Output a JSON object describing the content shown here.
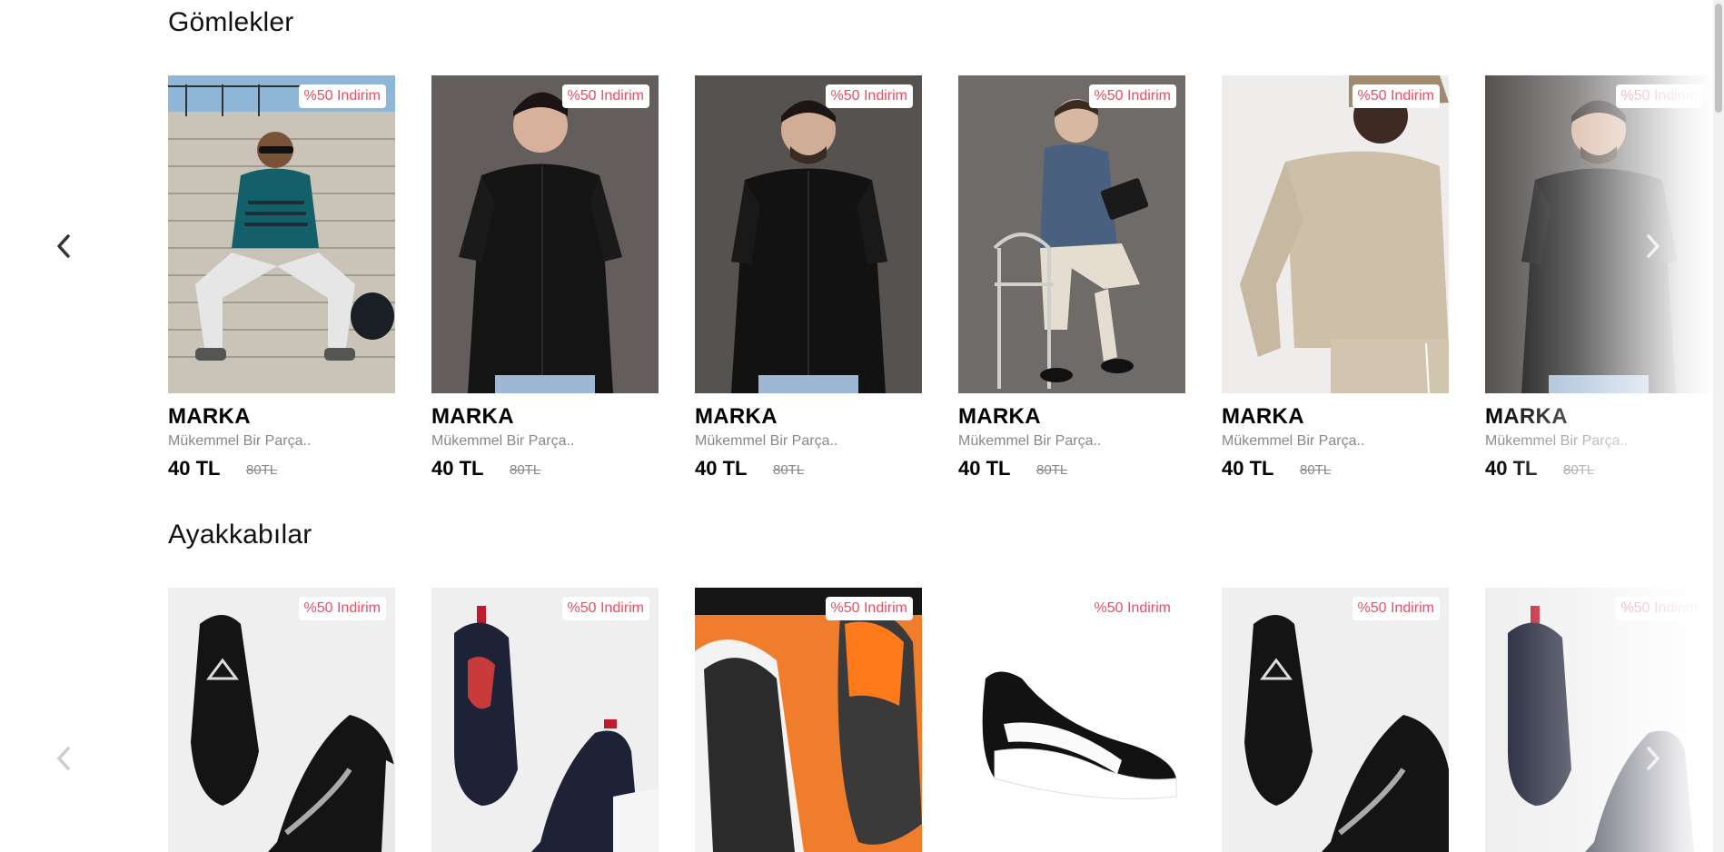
{
  "sections": [
    {
      "title": "Gömlekler",
      "products": [
        {
          "badge": "%50 Indirim",
          "brand": "MARKA",
          "desc": "Mükemmel Bir Parça..",
          "price": "40 TL",
          "old_price": "80TL"
        },
        {
          "badge": "%50 Indirim",
          "brand": "MARKA",
          "desc": "Mükemmel Bir Parça..",
          "price": "40 TL",
          "old_price": "80TL"
        },
        {
          "badge": "%50 Indirim",
          "brand": "MARKA",
          "desc": "Mükemmel Bir Parça..",
          "price": "40 TL",
          "old_price": "80TL"
        },
        {
          "badge": "%50 Indirim",
          "brand": "MARKA",
          "desc": "Mükemmel Bir Parça..",
          "price": "40 TL",
          "old_price": "80TL"
        },
        {
          "badge": "%50 Indirim",
          "brand": "MARKA",
          "desc": "Mükemmel Bir Parça..",
          "price": "40 TL",
          "old_price": "80TL"
        },
        {
          "badge": "%50 Indirim",
          "brand": "MARKA",
          "desc": "Mükemmel Bir Parça..",
          "price": "40 TL",
          "old_price": "80TL"
        }
      ]
    },
    {
      "title": "Ayakkabılar",
      "products": [
        {
          "badge": "%50 Indirim"
        },
        {
          "badge": "%50 Indirim"
        },
        {
          "badge": "%50 Indirim"
        },
        {
          "badge": "%50 Indirim"
        },
        {
          "badge": "%50 Indirim"
        },
        {
          "badge": "%50 Indirim"
        }
      ]
    }
  ],
  "icons": {
    "prev": "chevron-left-icon",
    "next": "chevron-right-icon"
  },
  "colors": {
    "badge_text": "#f24a63",
    "arrow_active": "#333333",
    "arrow_inactive": "#cccccc"
  }
}
